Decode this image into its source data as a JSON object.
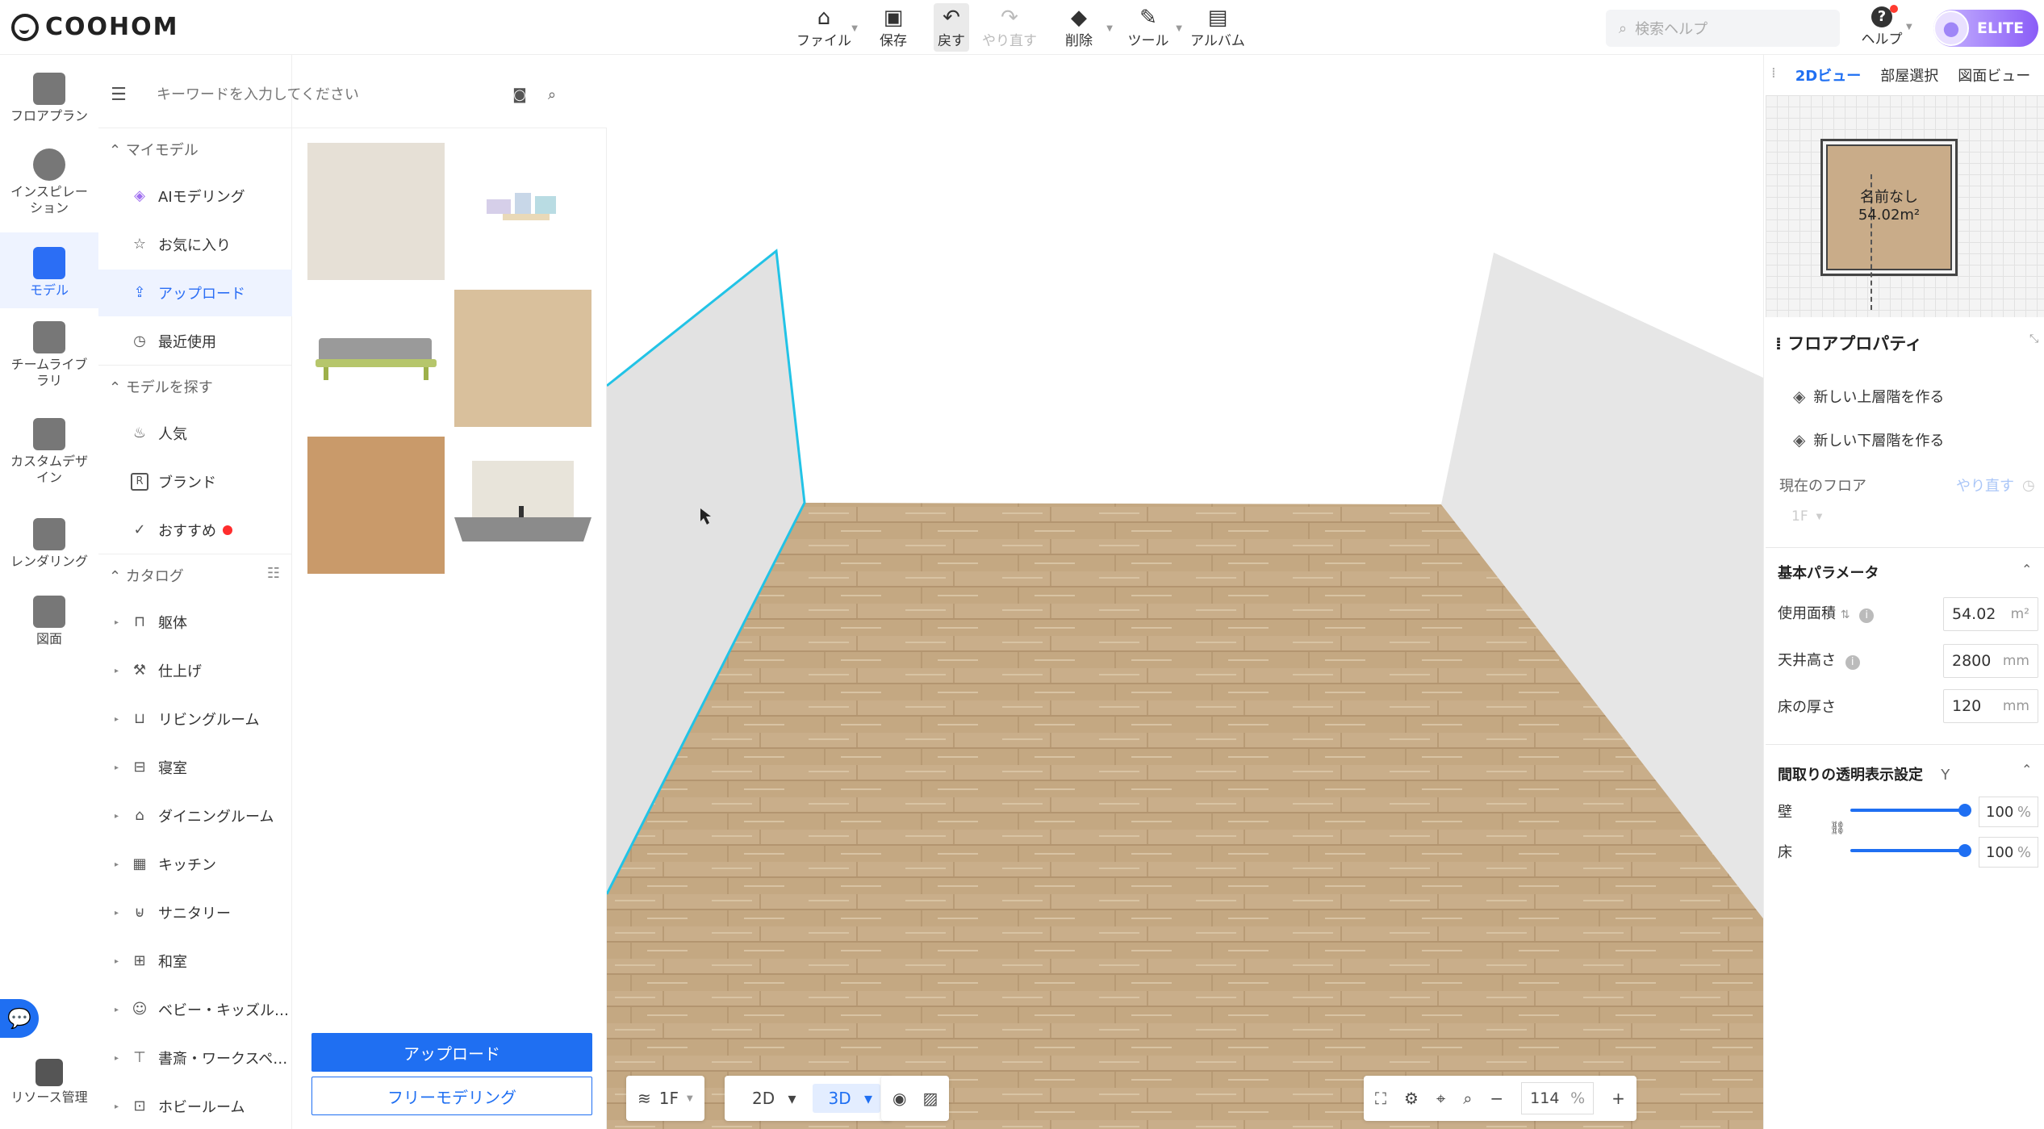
{
  "app": {
    "logo": "COOHOM"
  },
  "toolbar": {
    "items": [
      {
        "label": "ファイル",
        "icon": "home-icon",
        "caret": true
      },
      {
        "label": "保存",
        "icon": "save-icon"
      },
      {
        "label": "戻す",
        "icon": "undo-icon",
        "active": true
      },
      {
        "label": "やり直す",
        "icon": "redo-icon",
        "disabled": true
      },
      {
        "label": "削除",
        "icon": "eraser-icon",
        "caret": true
      },
      {
        "label": "ツール",
        "icon": "wrench-icon",
        "caret": true
      },
      {
        "label": "アルバム",
        "icon": "album-icon"
      }
    ]
  },
  "header": {
    "search_placeholder": "検索ヘルプ",
    "help_label": "ヘルプ",
    "user_tier": "ELITE"
  },
  "rail": {
    "items": [
      {
        "label": "フロアプラン",
        "icon": "floorplan-icon"
      },
      {
        "label": "インスピレーション",
        "icon": "lightbulb-icon"
      },
      {
        "label": "モデル",
        "icon": "sofa-icon",
        "active": true
      },
      {
        "label": "チームライブラリ",
        "icon": "crown-icon"
      },
      {
        "label": "カスタムデザイン",
        "icon": "custom-design-icon"
      },
      {
        "label": "レンダリング",
        "icon": "camera-icon"
      },
      {
        "label": "図面",
        "icon": "drawing-icon"
      },
      {
        "label": "リソース管理",
        "icon": "resource-icon"
      }
    ]
  },
  "catalog": {
    "search_placeholder": "キーワードを入力してください",
    "section_my": "マイモデル",
    "my_items": [
      {
        "label": "AIモデリング",
        "icon": "cube-ai-icon"
      },
      {
        "label": "お気に入り",
        "icon": "star-icon"
      },
      {
        "label": "アップロード",
        "icon": "upload-icon",
        "active": true
      },
      {
        "label": "最近使用",
        "icon": "clock-icon"
      }
    ],
    "section_find": "モデルを探す",
    "find_items": [
      {
        "label": "人気",
        "icon": "fire-icon"
      },
      {
        "label": "ブランド",
        "icon": "brand-icon"
      },
      {
        "label": "おすすめ",
        "icon": "check-circle-icon",
        "badge": true
      }
    ],
    "section_catalog": "カタログ",
    "catalog_items": [
      {
        "label": "躯体",
        "icon": "frame-icon"
      },
      {
        "label": "仕上げ",
        "icon": "roller-icon"
      },
      {
        "label": "リビングルーム",
        "icon": "sofa-icon"
      },
      {
        "label": "寝室",
        "icon": "bed-icon"
      },
      {
        "label": "ダイニングルーム",
        "icon": "dining-icon"
      },
      {
        "label": "キッチン",
        "icon": "kitchen-icon"
      },
      {
        "label": "サニタリー",
        "icon": "bath-icon"
      },
      {
        "label": "和室",
        "icon": "japanese-room-icon"
      },
      {
        "label": "ベビー・キッズル…",
        "icon": "baby-icon"
      },
      {
        "label": "書斎・ワークスペ…",
        "icon": "desk-icon"
      },
      {
        "label": "ホビールーム",
        "icon": "game-icon"
      }
    ],
    "upload_button": "アップロード",
    "free_modeling_button": "フリーモデリング"
  },
  "viewport": {
    "floor_label": "1F",
    "view_2d": "2D",
    "view_3d": "3D",
    "zoom_value": "114",
    "zoom_unit": "%"
  },
  "right_panel": {
    "tabs": [
      "2Dビュー",
      "部屋選択",
      "図面ビュー"
    ],
    "minimap_room_name": "名前なし",
    "minimap_room_area": "54.02m²",
    "title": "フロアプロパティ",
    "new_upper": "新しい上層階を作る",
    "new_lower": "新しい下層階を作る",
    "current_floor_label": "現在のフロア",
    "redo_link": "やり直す",
    "current_floor_value": "1F",
    "basic_params": "基本パラメータ",
    "area_label": "使用面積",
    "area_value": "54.02",
    "area_unit": "m²",
    "ceiling_label": "天井高さ",
    "ceiling_value": "2800",
    "ceiling_unit": "mm",
    "floor_thickness_label": "床の厚さ",
    "floor_thickness_value": "120",
    "floor_thickness_unit": "mm",
    "transparency_title": "間取りの透明表示設定",
    "transparency_hotkey": "Y",
    "wall_label": "壁",
    "wall_value": "100",
    "wall_level": 1.0,
    "floor_label": "床",
    "floor_value": "100",
    "floor_level": 1.0,
    "pct_unit": "%"
  },
  "colors": {
    "accent": "#1f6ff2",
    "wood": "#c4a882",
    "selection": "#22c3e6"
  }
}
